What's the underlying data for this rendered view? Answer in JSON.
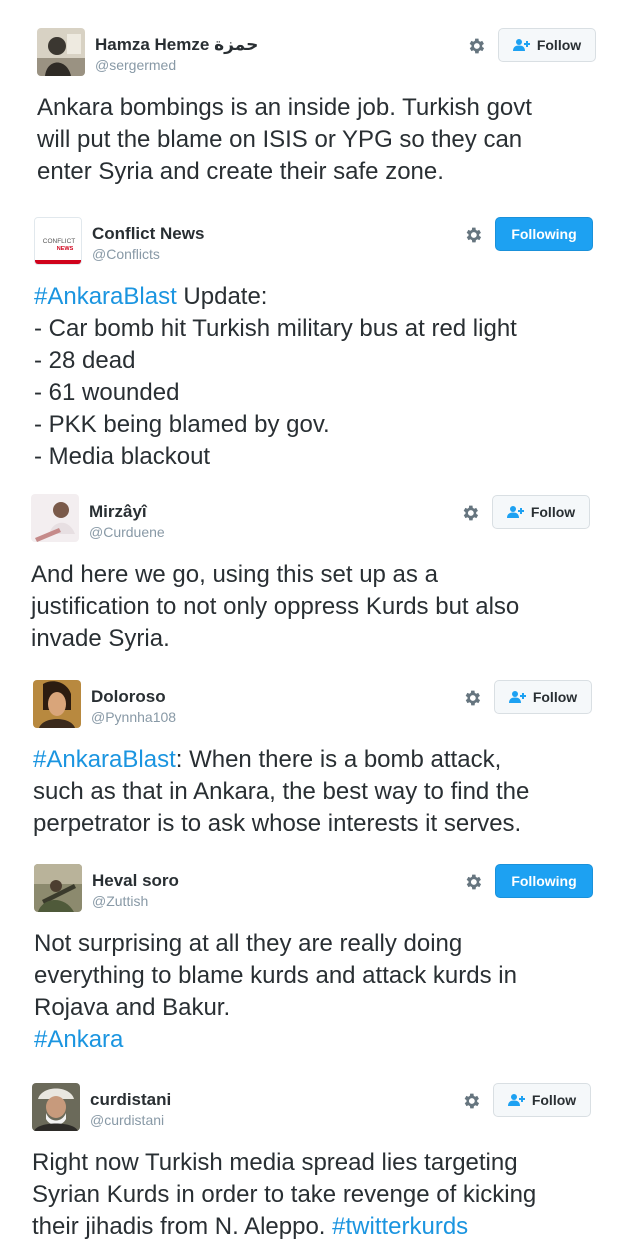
{
  "tweets": [
    {
      "name": "Hamza Hemze حمزة",
      "handle": "@sergermed",
      "button": "Follow",
      "lines": [
        [
          {
            "t": "Ankara bombings is an inside job. Turkish govt"
          }
        ],
        [
          {
            "t": "will put the blame on ISIS or YPG so they can"
          }
        ],
        [
          {
            "t": "enter Syria and create their safe zone."
          }
        ]
      ]
    },
    {
      "name": "Conflict News",
      "handle": "@Conflicts",
      "button": "Following",
      "avatar_text": [
        "CONFLICT",
        "NEWS"
      ],
      "lines": [
        [
          {
            "t": "#AnkaraBlast",
            "h": true
          },
          {
            "t": " Update:"
          }
        ],
        [
          {
            "t": "- Car bomb hit Turkish military bus at red light"
          }
        ],
        [
          {
            "t": "- 28 dead"
          }
        ],
        [
          {
            "t": "- 61 wounded"
          }
        ],
        [
          {
            "t": "- PKK being blamed by gov."
          }
        ],
        [
          {
            "t": "- Media blackout"
          }
        ]
      ]
    },
    {
      "name": "Mirzâyî",
      "handle": "@Curduene",
      "button": "Follow",
      "lines": [
        [
          {
            "t": "And here we go, using this set up as a"
          }
        ],
        [
          {
            "t": "justification to not only oppress Kurds but also"
          }
        ],
        [
          {
            "t": "invade Syria."
          }
        ]
      ]
    },
    {
      "name": "Doloroso",
      "handle": "@Pynnha108",
      "button": "Follow",
      "lines": [
        [
          {
            "t": "#AnkaraBlast",
            "h": true
          },
          {
            "t": ": When there is a bomb attack,"
          }
        ],
        [
          {
            "t": "such as that in Ankara, the best way to find the"
          }
        ],
        [
          {
            "t": "perpetrator is to ask whose interests it serves."
          }
        ]
      ]
    },
    {
      "name": "Heval soro",
      "handle": "@Zuttish",
      "button": "Following",
      "lines": [
        [
          {
            "t": "Not surprising at all they are really doing"
          }
        ],
        [
          {
            "t": "everything to blame kurds and attack kurds in"
          }
        ],
        [
          {
            "t": "Rojava and Bakur."
          }
        ],
        [
          {
            "t": "#Ankara",
            "h": true
          }
        ]
      ]
    },
    {
      "name": "curdistani",
      "handle": "@curdistani",
      "button": "Follow",
      "lines": [
        [
          {
            "t": "Right now Turkish media spread lies targeting"
          }
        ],
        [
          {
            "t": "Syrian Kurds in order to take revenge of kicking"
          }
        ],
        [
          {
            "t": "their jihadis from N. Aleppo. "
          },
          {
            "t": "#twitterkurds",
            "h": true
          }
        ]
      ]
    }
  ],
  "colors": {
    "hashtag": "#1b95e0",
    "following_button": "#1da1f2",
    "text": "#292f33",
    "handle": "#8899a6",
    "gear": "#66757f"
  },
  "icons": {
    "settings": "gear-icon",
    "follow": "follow-person-plus-icon"
  }
}
